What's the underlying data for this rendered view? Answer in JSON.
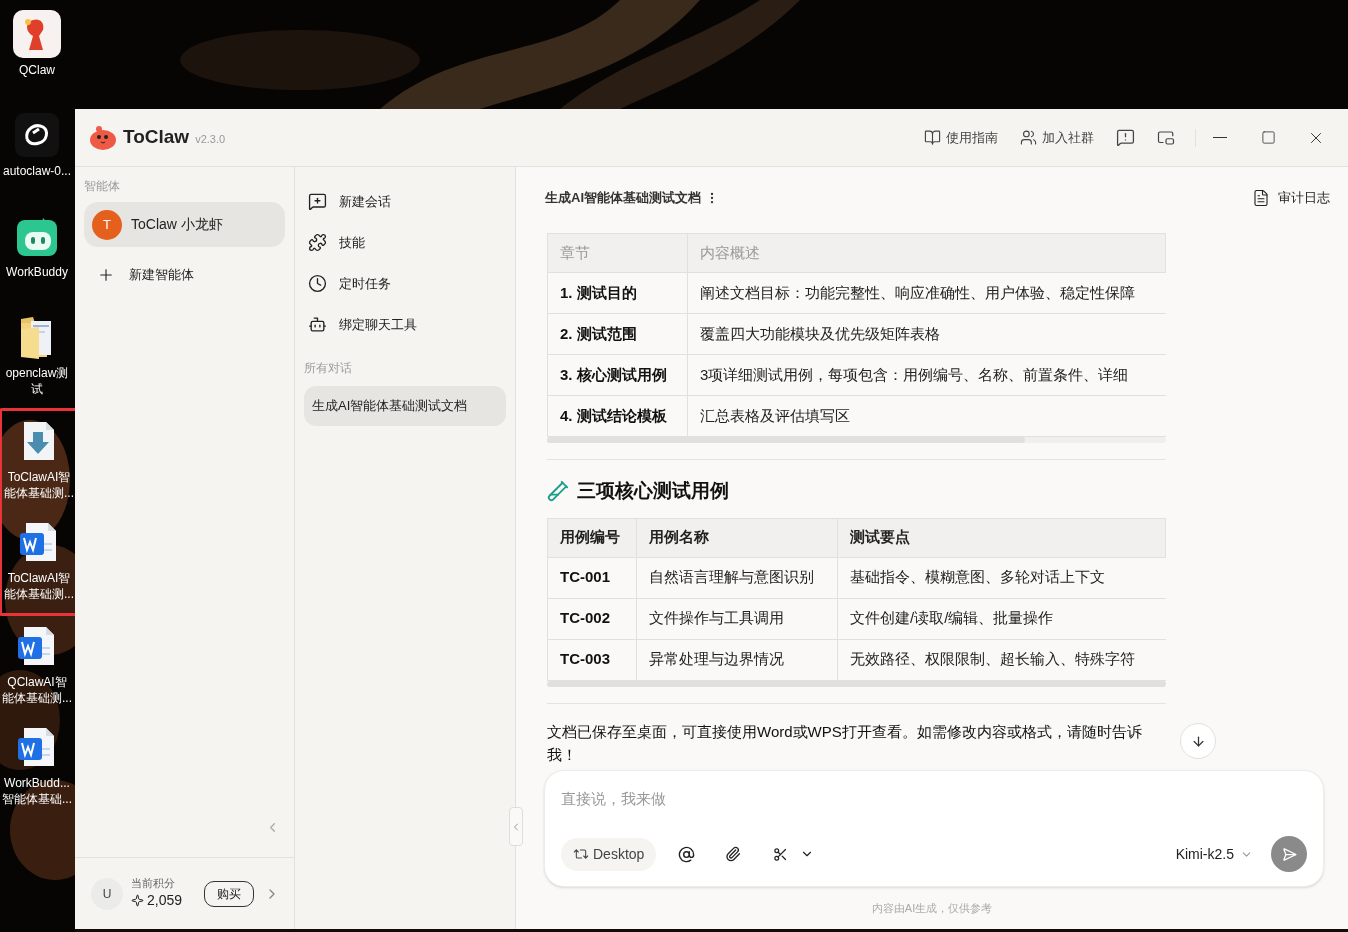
{
  "desktop": {
    "icons": [
      {
        "kind": "qclaw",
        "label_lines": [
          "QClaw"
        ],
        "highlighted": false
      },
      {
        "kind": "autoclaw",
        "label_lines": [
          "autoclaw-0..."
        ],
        "highlighted": false
      },
      {
        "kind": "workbuddy",
        "label_lines": [
          "WorkBuddy"
        ],
        "highlighted": false
      },
      {
        "kind": "folder",
        "label_lines": [
          "openclaw测",
          "试"
        ],
        "highlighted": false
      },
      {
        "kind": "download",
        "label_lines": [
          "ToClawAI智",
          "能体基础测..."
        ],
        "highlighted": true
      },
      {
        "kind": "word",
        "label_lines": [
          "ToClawAI智",
          "能体基础测..."
        ],
        "highlighted": true
      },
      {
        "kind": "word",
        "label_lines": [
          "QClawAI智",
          "能体基础测..."
        ],
        "highlighted": false
      },
      {
        "kind": "word",
        "label_lines": [
          "WorkBudd...",
          "智能体基础..."
        ],
        "highlighted": false
      }
    ]
  },
  "window": {
    "app_name": "ToClaw",
    "version": "v2.3.0",
    "toolbar": [
      {
        "kind": "guide",
        "label": "使用指南"
      },
      {
        "kind": "community",
        "label": "加入社群"
      },
      {
        "kind": "feedback"
      },
      {
        "kind": "pip"
      }
    ]
  },
  "agents": {
    "heading": "智能体",
    "items": [
      {
        "initial": "T",
        "name": "ToClaw 小龙虾",
        "selected": true
      }
    ],
    "new_label": "新建智能体"
  },
  "account": {
    "initial": "U",
    "points_label": "当前积分",
    "points": "2,059",
    "buy_label": "购买"
  },
  "nav": [
    {
      "kind": "new-chat",
      "label": "新建会话"
    },
    {
      "kind": "skills",
      "label": "技能"
    },
    {
      "kind": "schedule",
      "label": "定时任务"
    },
    {
      "kind": "bot",
      "label": "绑定聊天工具"
    }
  ],
  "conversations": {
    "heading": "所有对话",
    "items": [
      {
        "title": "生成AI智能体基础测试文档",
        "selected": true
      }
    ]
  },
  "chat": {
    "title": "生成AI智能体基础测试文档",
    "audit_label": "审计日志",
    "blocks": [
      {
        "kind": "table",
        "header_faded": true,
        "columns": [
          "章节",
          "内容概述"
        ],
        "rows": [
          [
            "1. 测试目的",
            "阐述文档目标：功能完整性、响应准确性、用户体验、稳定性保障"
          ],
          [
            "2. 测试范围",
            "覆盖四大功能模块及优先级矩阵表格"
          ],
          [
            "3. 核心测试用例",
            "3项详细测试用例，每项包含：用例编号、名称、前置条件、详细"
          ],
          [
            "4. 测试结论模板",
            "汇总表格及评估填写区"
          ]
        ]
      },
      {
        "kind": "heading",
        "text": "三项核心测试用例"
      },
      {
        "kind": "table",
        "header_faded": false,
        "columns": [
          "用例编号",
          "用例名称",
          "测试要点"
        ],
        "rows": [
          [
            "TC-001",
            "自然语言理解与意图识别",
            "基础指令、模糊意图、多轮对话上下文"
          ],
          [
            "TC-002",
            "文件操作与工具调用",
            "文件创建/读取/编辑、批量操作"
          ],
          [
            "TC-003",
            "异常处理与边界情况",
            "无效路径、权限限制、超长输入、特殊字符"
          ]
        ]
      },
      {
        "kind": "paragraph",
        "text": "文档已保存至桌面，可直接使用Word或WPS打开查看。如需修改内容或格式，请随时告诉我！"
      }
    ]
  },
  "composer": {
    "placeholder": "直接说，我来做",
    "location": "Desktop",
    "model": "Kimi-k2.5"
  },
  "footer_note": "内容由AI生成，仅供参考"
}
